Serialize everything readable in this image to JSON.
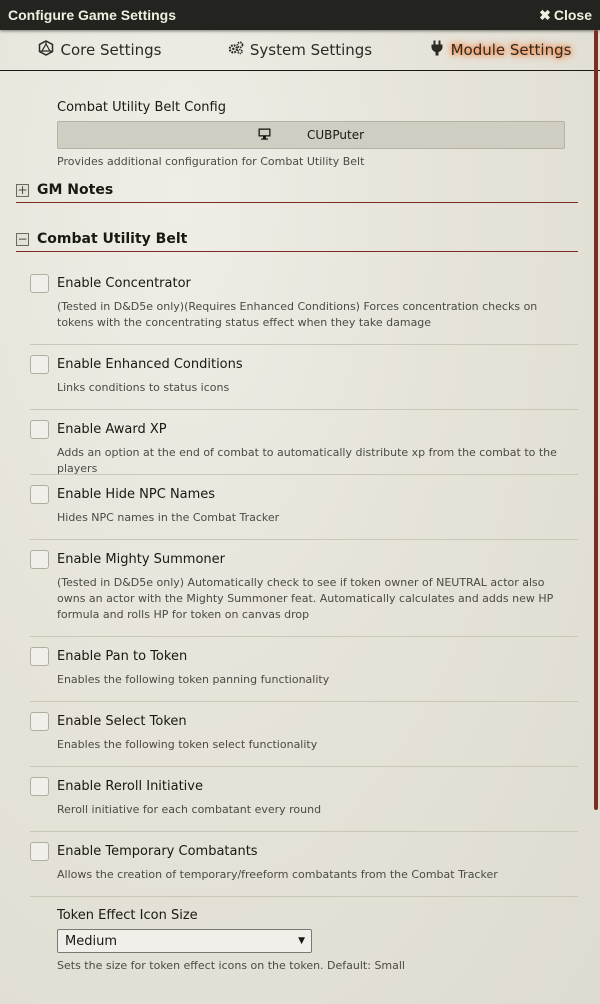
{
  "window": {
    "title": "Configure Game Settings",
    "close_label": "Close"
  },
  "tabs": [
    {
      "label": "Core Settings",
      "icon": "d20-icon"
    },
    {
      "label": "System Settings",
      "icon": "gears-icon"
    },
    {
      "label": "Module Settings",
      "icon": "plug-icon",
      "active": true
    }
  ],
  "menu_setting": {
    "label": "Combat Utility Belt Config",
    "button_label": "CUBPuter",
    "button_icon": "desktop-icon",
    "hint": "Provides additional configuration for Combat Utility Belt"
  },
  "modules": [
    {
      "name": "GM Notes",
      "expanded": false
    },
    {
      "name": "Combat Utility Belt",
      "expanded": true
    }
  ],
  "settings": [
    {
      "label": "Enable Concentrator",
      "checked": false,
      "hint": "(Tested in D&D5e only)(Requires Enhanced Conditions) Forces concentration checks on tokens with the concentrating status effect when they take damage"
    },
    {
      "label": "Enable Enhanced Conditions",
      "checked": false,
      "hint": "Links conditions to status icons"
    },
    {
      "label": "Enable Award XP",
      "checked": false,
      "hint": "Adds an option at the end of combat to automatically distribute xp from the combat to the players"
    },
    {
      "label": "Enable Hide NPC Names",
      "checked": false,
      "hint": "Hides NPC names in the Combat Tracker"
    },
    {
      "label": "Enable Mighty Summoner",
      "checked": false,
      "hint": "(Tested in D&D5e only) Automatically check to see if token owner of NEUTRAL actor also owns an actor with the Mighty Summoner feat. Automatically calculates and adds new HP formula and rolls HP for token on canvas drop"
    },
    {
      "label": "Enable Pan to Token",
      "checked": false,
      "hint": "Enables the following token panning functionality"
    },
    {
      "label": "Enable Select Token",
      "checked": false,
      "hint": "Enables the following token select functionality"
    },
    {
      "label": "Enable Reroll Initiative",
      "checked": false,
      "hint": "Reroll initiative for each combatant every round"
    },
    {
      "label": "Enable Temporary Combatants",
      "checked": false,
      "hint": "Allows the creation of temporary/freeform combatants from the Combat Tracker"
    }
  ],
  "select_setting": {
    "label": "Token Effect Icon Size",
    "value": "Medium",
    "hint": "Sets the size for token effect icons on the token. Default: Small"
  },
  "colors": {
    "accent": "#782e22",
    "titlebar": "#232320",
    "active_glow": "#ff6400"
  }
}
